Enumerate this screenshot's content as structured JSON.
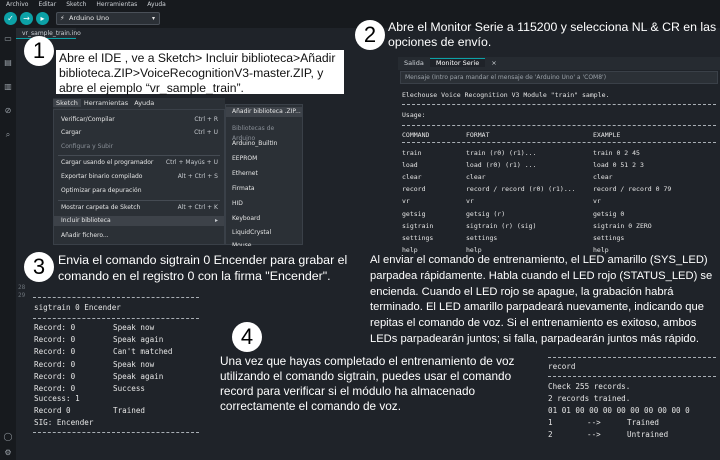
{
  "menubar": [
    "Archivo",
    "Editar",
    "Sketch",
    "Herramientas",
    "Ayuda"
  ],
  "toolbar": {
    "board": "Arduino Uno"
  },
  "tab": "vr_sample_train.ino",
  "steps": {
    "s1": {
      "num": "1",
      "text": "Abre el IDE , ve a Sketch> Incluir biblioteca>Añadir biblioteca.ZIP>VoiceRecognitionV3-master.ZIP, y abre el ejemplo “vr_sample_train”."
    },
    "s2": {
      "num": "2",
      "text": "Abre el Monitor Serie a 115200 y selecciona NL & CR en las opciones de envío."
    },
    "s3": {
      "num": "3",
      "text": "Envia el comando sigtrain 0 Encender  para grabar el comando en el registro 0 con la firma \"Encender\"."
    },
    "s4": {
      "num": "4",
      "text": "Una vez que hayas completado el entrenamiento de voz utilizando el comando sigtrain, puedes usar el comando record para verificar si el módulo ha almacenado correctamente el comando de voz."
    }
  },
  "ledText": "Al enviar el comando de entrenamiento, el LED amarillo (SYS_LED) parpadea rápidamente. Habla cuando el LED rojo (STATUS_LED) se encienda. Cuando el LED rojo se apague, la grabación habrá terminado. El LED amarillo parpadeará nuevamente, indicando que repitas el comando de voz. Si el entrenamiento es exitoso, ambos LEDs parpadearán juntos; si falla, parpadearán juntos más rápido.",
  "sketchMenu": {
    "strip": [
      "Sketch",
      "Herramientas",
      "Ayuda"
    ],
    "items": [
      {
        "label": "Verificar/Compilar",
        "shortcut": "Ctrl + R"
      },
      {
        "label": "Cargar",
        "shortcut": "Ctrl + U"
      },
      {
        "label": "Configura y Subir",
        "shortcut": ""
      },
      {
        "label": "Cargar usando el programador",
        "shortcut": "Ctrl + Mayús + U"
      },
      {
        "label": "Exportar binario compilado",
        "shortcut": "Alt + Ctrl + S"
      },
      {
        "label": "Optimizar para depuración",
        "shortcut": ""
      },
      {
        "label": "Mostrar carpeta de Sketch",
        "shortcut": "Alt + Ctrl + K"
      },
      {
        "label": "Incluir biblioteca",
        "shortcut": "▸"
      },
      {
        "label": "Añadir fichero...",
        "shortcut": ""
      }
    ]
  },
  "libMenu": [
    "Añadir biblioteca .ZIP...",
    "Bibliotecas de Arduino",
    "Arduino_BuiltIn",
    "EEPROM",
    "Ethernet",
    "Firmata",
    "HID",
    "Keyboard",
    "LiquidCrystal",
    "Mouse"
  ],
  "serial": {
    "tabs": [
      "Salida",
      "Monitor Serie"
    ],
    "placeholder": "Mensaje (Intro para mandar el mensaje de 'Arduino Uno' a 'COM8')",
    "banner": "Elechouse Voice Recognition V3 Module \"train\" sample.",
    "usage": "Usage:",
    "headers": [
      "COMMAND",
      "FORMAT",
      "EXAMPLE"
    ],
    "rows": [
      [
        "train",
        "train (r0) (r1)...",
        "train 0 2 45"
      ],
      [
        "load",
        "load (r0) (r1) ...",
        "load 0 51 2 3"
      ],
      [
        "clear",
        "clear",
        "clear"
      ],
      [
        "record",
        "record / record (r0) (r1)...",
        "record / record 0 79"
      ],
      [
        "vr",
        "vr",
        "vr"
      ],
      [
        "getsig",
        "getsig (r)",
        "getsig 0"
      ],
      [
        "sigtrain",
        "sigtrain (r) (sig)",
        "sigtrain 0 ZERO"
      ],
      [
        "settings",
        "settings",
        "settings"
      ],
      [
        "help",
        "help",
        "help"
      ]
    ]
  },
  "trainLog": {
    "lineNumbers": [
      "28",
      "29"
    ],
    "title": "sigtrain 0 Encender",
    "rows": [
      [
        "Record: 0",
        "Speak now"
      ],
      [
        "Record: 0",
        "Speak again"
      ],
      [
        "Record: 0",
        "Can't matched"
      ],
      [
        "Record: 0",
        "Speak now"
      ],
      [
        "Record: 0",
        "Speak again"
      ],
      [
        "Record: 0",
        "Success"
      ]
    ],
    "success": "Success: 1",
    "final": [
      "Record 0",
      "Trained"
    ],
    "sig": "SIG: Encender"
  },
  "recordLog": {
    "title": "record",
    "check": "Check 255 records.",
    "trained": "2 records trained.",
    "bits": "01 01 00 00 00 00 00 00 00 00 0",
    "rows": [
      [
        "1",
        "-->",
        "Trained"
      ],
      [
        "2",
        "-->",
        "Untrained"
      ]
    ]
  }
}
